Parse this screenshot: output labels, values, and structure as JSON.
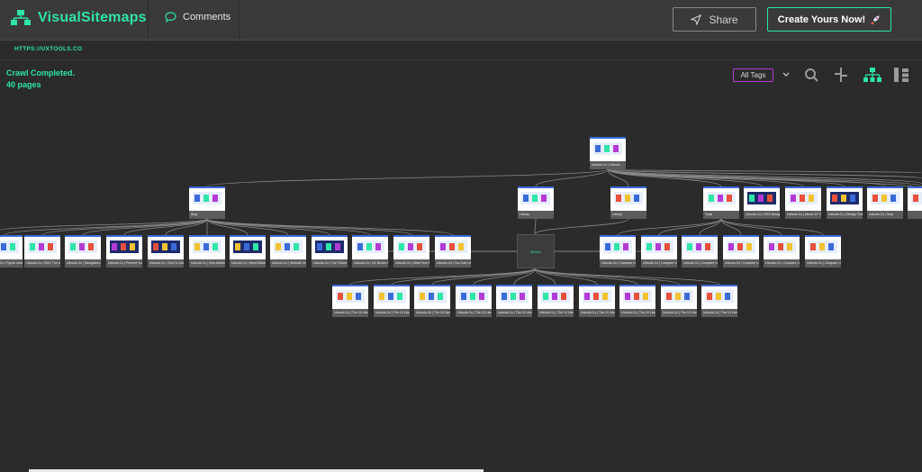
{
  "app": {
    "name": "VisualSitemaps",
    "comments_label": "Comments",
    "share_label": "Share",
    "create_label": "Create Yours Now!"
  },
  "site": {
    "url": "HTTPS://UXTOOLS.CO"
  },
  "status": {
    "crawl": "Crawl Completed.",
    "pages": "40 pages"
  },
  "toolbar": {
    "tags_label": "All Tags",
    "icons": [
      "chevron-down-icon",
      "search-icon",
      "collapse-icon",
      "tree-layout-icon",
      "vertical-layout-icon"
    ]
  },
  "colors": {
    "accent": "#2ee6a6",
    "tag_border": "#b43ad6",
    "background": "#2b2b2b",
    "topbar": "#3a3a3a"
  },
  "sitemap": {
    "root": {
      "label": "Uxtools.Co | Uxtools"
    },
    "level1": [
      {
        "label": "Blog"
      },
      {
        "label": "Library"
      },
      {
        "label": "Library"
      },
      {
        "label": "Tools"
      },
      {
        "label": "Uxtools.Co | 2019 Design Tools Survey"
      },
      {
        "label": "Uxtools.Co | About UX Tools"
      },
      {
        "label": "Uxtools.Co | Design Tools Survey"
      },
      {
        "label": "Uxtools.Co | Sear"
      }
    ],
    "blog_children": [
      {
        "label": "Uxtools.Co | Figma Variable..."
      },
      {
        "label": "Uxtools.Co | 2021 The UX Prototyping Tools..."
      },
      {
        "label": "Uxtools.Co | Navigation Learning..."
      },
      {
        "label": "Uxtools.Co | Prevent Your Stakeholders Fr..."
      },
      {
        "label": "Uxtools.Co | How To Use Prompts For Ma..."
      },
      {
        "label": "Uxtools.Co | How Adobe XD Presents..."
      },
      {
        "label": "Uxtools.Co | Need Make Prototyping U..."
      },
      {
        "label": "Uxtools.Co | Website Vs. Adobe XD Vs. Fi..."
      },
      {
        "label": "Uxtools.Co | The Future Of The UX De..."
      },
      {
        "label": "Uxtools.Co | UX Books Survey Result..."
      },
      {
        "label": "Uxtools.Co | Want Your Relations Are..."
      },
      {
        "label": "Uxtools.Co | You Can Use Prompts Mo..."
      }
    ],
    "center_label": "Books",
    "tools_children": [
      {
        "label": "Uxtools.Co | Compare UX Tools"
      },
      {
        "label": "Uxtools.Co | Compare UX Tools"
      },
      {
        "label": "Uxtools.Co | Compare UX Tools"
      },
      {
        "label": "Uxtools.Co | Compare UX Tools"
      },
      {
        "label": "Uxtools.Co | Compare UX Tools"
      },
      {
        "label": "Uxtools.Co | Compare UX Tools"
      }
    ],
    "library_children": [
      {
        "label": "Uxtools.Co | The 10 Library"
      },
      {
        "label": "Uxtools.Co | The 10 Library"
      },
      {
        "label": "Uxtools.Co | The 10 Library"
      },
      {
        "label": "Uxtools.Co | The 10 Library"
      },
      {
        "label": "Uxtools.Co | The 10 Library"
      },
      {
        "label": "Uxtools.Co | The 10 Library"
      },
      {
        "label": "Uxtools.Co | The 10 Library"
      },
      {
        "label": "Uxtools.Co | The 10 Library"
      },
      {
        "label": "Uxtools.Co | The 10 Library"
      },
      {
        "label": "Uxtools.Co | The 10 Library"
      }
    ]
  }
}
